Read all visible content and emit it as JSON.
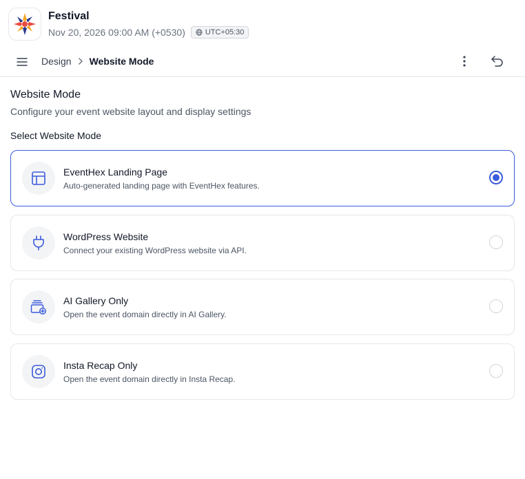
{
  "event": {
    "title": "Festival",
    "datetime": "Nov 20, 2026 09:00 AM (+0530)",
    "timezone": "UTC+05:30",
    "logo_icon": "festival-logo-icon"
  },
  "toolbar": {
    "menu_icon": "hamburger-menu-icon",
    "breadcrumb": {
      "parent": "Design",
      "current": "Website Mode"
    },
    "more_icon": "vertical-ellipsis-icon",
    "undo_icon": "undo-icon"
  },
  "page": {
    "title": "Website Mode",
    "subtitle": "Configure your event website layout and display settings",
    "section_label": "Select Website Mode"
  },
  "modes": [
    {
      "title": "EventHex Landing Page",
      "description": "Auto-generated landing page with EventHex features.",
      "icon": "layout-icon",
      "selected": true
    },
    {
      "title": "WordPress Website",
      "description": "Connect your existing WordPress website via API.",
      "icon": "plug-icon",
      "selected": false
    },
    {
      "title": "AI Gallery Only",
      "description": "Open the event domain directly in AI Gallery.",
      "icon": "gallery-add-icon",
      "selected": false
    },
    {
      "title": "Insta Recap Only",
      "description": "Open the event domain directly in Insta Recap.",
      "icon": "instagram-icon",
      "selected": false
    }
  ],
  "colors": {
    "accent": "#3b5bdb",
    "border": "#e5e7eb",
    "icon_bg": "#f3f4f6"
  }
}
